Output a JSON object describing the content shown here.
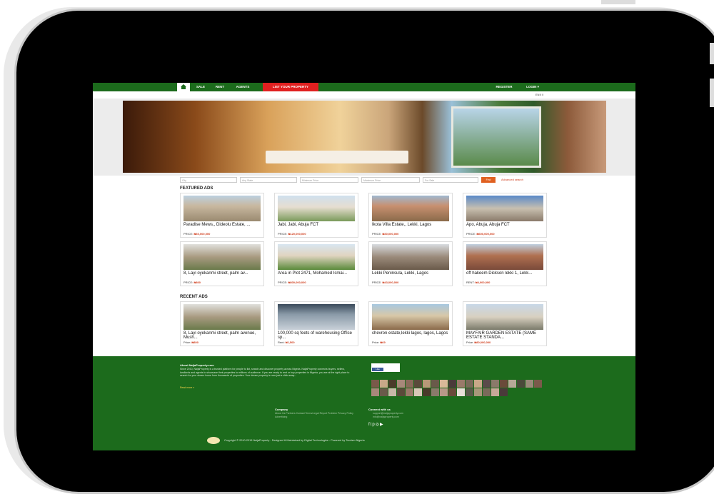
{
  "nav": {
    "items": [
      {
        "label": "SALE"
      },
      {
        "label": "RENT"
      },
      {
        "label": "AGENTS"
      },
      {
        "label": "LIST YOUR PROPERTY"
      }
    ],
    "register": "REGISTER",
    "login": "LOGIN ▾"
  },
  "lang": "EN ‖ ‖",
  "search": {
    "city": "City",
    "state": "Any State",
    "min": "Minimum Price",
    "max": "Maximum Price",
    "type": "For Sale",
    "find": "Find",
    "advanced": "Advanced search"
  },
  "featured": {
    "title": "FEATURED ADS",
    "cards": [
      {
        "title": "Paradise Mews,, Dideolu Estate, ...",
        "price_label": "PRICE:",
        "price": "₦60,000,000"
      },
      {
        "title": "Jabi, Jabi, Abuja FCT",
        "price_label": "PRICE:",
        "price": "₦120,000,000"
      },
      {
        "title": "Ikota Villa Estate,, Lekki, Lagos",
        "price_label": "PRICE:",
        "price": "₦30,000,000"
      },
      {
        "title": "Apo, Abuja, Abuja FCT",
        "price_label": "PRICE:",
        "price": "₦600,000,000"
      },
      {
        "title": "8, Layi oyekanmi street, palm av...",
        "price_label": "PRICE:",
        "price": "₦800"
      },
      {
        "title": "Area in Plot 2471, Mohamed Ismai...",
        "price_label": "PRICE:",
        "price": "₦800,000,000"
      },
      {
        "title": "Lekki Peninsula, Lekki, Lagos",
        "price_label": "PRICE:",
        "price": "₦43,000,000"
      },
      {
        "title": "off hakeem Dickson lekki 1, Lekk...",
        "price_label": "RENT:",
        "price": "₦4,000,000"
      }
    ]
  },
  "recent": {
    "title": "RECENT ADS",
    "cards": [
      {
        "title": "8, Layi oyekanmi street, palm avenue, Mush...",
        "price_label": "Price:",
        "price": "₦800"
      },
      {
        "title": "100,000 sq feets of warehousing Office sp...",
        "price_label": "Rent:",
        "price": "₦1,500"
      },
      {
        "title": "chevron estate,lekki lagos, lagos, Lagos",
        "price_label": "Price:",
        "price": "₦69"
      },
      {
        "title": "MAYFAIR GARDEN ESTATE (SAME ESTATE STANDA...",
        "price_label": "Price:",
        "price": "₦80,000,000"
      }
    ]
  },
  "footer": {
    "about_title": "About NaijaProperty.com",
    "about_text": "Since 2010, NaijaProperty is a trusted platform for people to list, search and discover property across Nigeria. NaijaProperty connects buyers, sellers, landlords and agents to showcase their properties to millions of audience. If you are ready to rent or buy properties in Nigeria, you are at the right place to search for your dream home from thousands of properties. Your dream property is now just a click away...",
    "read_more": "Read more »",
    "fb_like": "Like",
    "company_title": "Company",
    "company_links": "About Us   Partners   Contact   Terms/Legal   Report Problem   Privacy Policy   Advertising",
    "connect_title": "Connect with us",
    "connect_email": "support@naijaproperty.com",
    "connect_phone": "info@naijaproperty.com",
    "copyright": "Copyright © 2010-2015 NaijaProperty - Designed & Maintained by Digital Technologies - Powered by Tourism Nigeria"
  },
  "icons": {
    "home": "home-icon",
    "social": "facebook twitter pinterest instagram youtube"
  },
  "colors": {
    "brand_green": "#1c6b1c",
    "accent_red": "#e02020",
    "price": "#d04020"
  }
}
